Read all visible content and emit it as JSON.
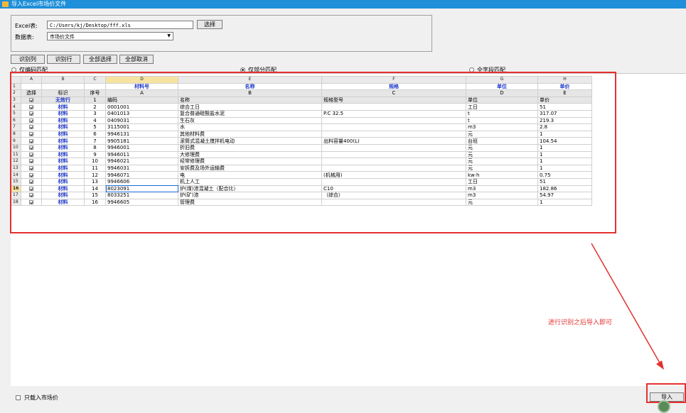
{
  "window": {
    "title": "导入Excel市场价文件"
  },
  "form": {
    "excel_label": "Excel表:",
    "excel_path": "C:/Users/kj/Desktop/fff.xls",
    "choose_button": "选择",
    "sheet_label": "数据表:",
    "sheet_value": "市场价文件"
  },
  "toolbar": {
    "identify_columns": "识别列",
    "identify_rows": "识别行",
    "select_all": "全部选择",
    "cancel_all": "全部取消"
  },
  "match_options": [
    {
      "label": "仅编码匹配",
      "selected": false
    },
    {
      "label": "仅部分匹配",
      "selected": true
    },
    {
      "label": "全字段匹配",
      "selected": false
    }
  ],
  "grid": {
    "col_letters": [
      "A",
      "B",
      "C",
      "D",
      "E",
      "F",
      "G",
      "H"
    ],
    "row1_mapping": [
      "",
      "",
      "",
      "材料号",
      "名称",
      "规格",
      "单位",
      "单价"
    ],
    "row2_headers": [
      "选择",
      "标识",
      "序号",
      "A",
      "B",
      "C",
      "D",
      "E"
    ],
    "row3_headers": [
      "",
      "无效行",
      "1",
      "编码",
      "名称",
      "规格型号",
      "单位",
      "单价"
    ],
    "data_rows": [
      {
        "row": "4",
        "flag": "材料",
        "seq": "2",
        "code": "0001001",
        "name": "综合工日",
        "spec": "",
        "unit": "工日",
        "price": "51"
      },
      {
        "row": "5",
        "flag": "材料",
        "seq": "3",
        "code": "0401013",
        "name": "复合普通硅酸盐水泥",
        "spec": "P.C 32.5",
        "unit": "t",
        "price": "317.07"
      },
      {
        "row": "6",
        "flag": "材料",
        "seq": "4",
        "code": "0409031",
        "name": "生石灰",
        "spec": "",
        "unit": "t",
        "price": "219.3"
      },
      {
        "row": "7",
        "flag": "材料",
        "seq": "5",
        "code": "3115001",
        "name": "水",
        "spec": "",
        "unit": "m3",
        "price": "2.8"
      },
      {
        "row": "8",
        "flag": "材料",
        "seq": "6",
        "code": "9946131",
        "name": "其他材料费",
        "spec": "",
        "unit": "元",
        "price": "1"
      },
      {
        "row": "9",
        "flag": "材料",
        "seq": "7",
        "code": "9905181",
        "name": "滚筒式混凝土搅拌机电动",
        "spec": "出料容量400(L)",
        "unit": "台班",
        "price": "104.54"
      },
      {
        "row": "10",
        "flag": "材料",
        "seq": "8",
        "code": "9946001",
        "name": "折旧费",
        "spec": "",
        "unit": "元",
        "price": "1"
      },
      {
        "row": "11",
        "flag": "材料",
        "seq": "9",
        "code": "9946011",
        "name": "大修理费",
        "spec": "",
        "unit": "元",
        "price": "1"
      },
      {
        "row": "12",
        "flag": "材料",
        "seq": "10",
        "code": "9946021",
        "name": "经常修理费",
        "spec": "",
        "unit": "元",
        "price": "1"
      },
      {
        "row": "13",
        "flag": "材料",
        "seq": "11",
        "code": "9946031",
        "name": "安拆费及场外运输费",
        "spec": "",
        "unit": "元",
        "price": "1"
      },
      {
        "row": "14",
        "flag": "材料",
        "seq": "12",
        "code": "9946071",
        "name": "电",
        "spec": "(机械用)",
        "unit": "kw·h",
        "price": "0.75"
      },
      {
        "row": "15",
        "flag": "材料",
        "seq": "13",
        "code": "9946606",
        "name": "机上人工",
        "spec": "",
        "unit": "工日",
        "price": "51"
      },
      {
        "row": "16",
        "flag": "材料",
        "seq": "14",
        "code": "8023091",
        "name": "炉(煤)渣混凝土（配合比）",
        "spec": "C10",
        "unit": "m3",
        "price": "182.86"
      },
      {
        "row": "17",
        "flag": "材料",
        "seq": "15",
        "code": "8033251",
        "name": "炉(矿)渣",
        "spec": "（综合）",
        "unit": "m3",
        "price": "54.97"
      },
      {
        "row": "18",
        "flag": "材料",
        "seq": "16",
        "code": "9946605",
        "name": "管理费",
        "spec": "",
        "unit": "元",
        "price": "1"
      }
    ]
  },
  "annotation": {
    "text": "进行识别之后导入即可"
  },
  "footer": {
    "only_market_price": "只载入市场价",
    "import_button": "导入"
  },
  "colors": {
    "accent": "#1e8fd8",
    "highlight": "#e53030",
    "mapping_text": "#1a35c8"
  }
}
